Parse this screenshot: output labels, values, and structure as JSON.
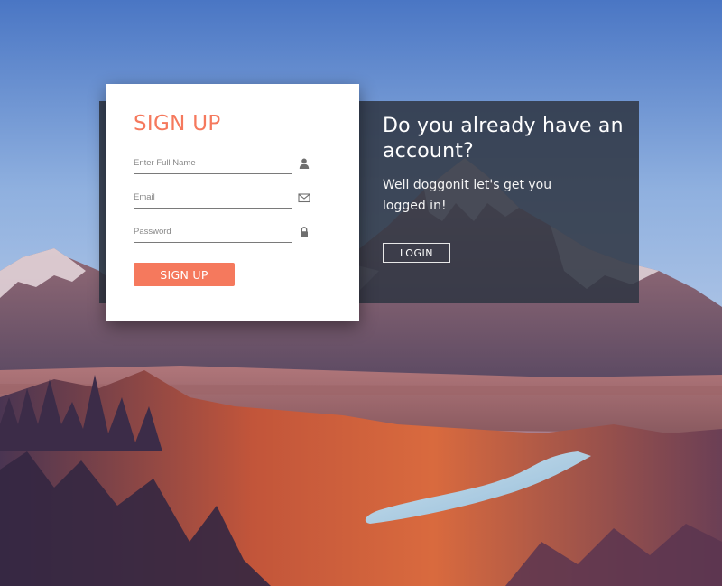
{
  "signup": {
    "title": "SIGN UP",
    "fields": [
      {
        "placeholder": "Enter Full Name",
        "value": "",
        "icon": "user-icon"
      },
      {
        "placeholder": "Email",
        "value": "",
        "icon": "envelope-icon"
      },
      {
        "placeholder": "Password",
        "value": "",
        "icon": "lock-icon"
      }
    ],
    "button_label": "SIGN UP"
  },
  "login_panel": {
    "title": "Do you already have an account?",
    "text": "Well doggonit let's get you logged in!",
    "button_label": "LOGIN"
  },
  "colors": {
    "accent": "#f5795d",
    "panel": "#2e3642",
    "card": "#ffffff"
  }
}
